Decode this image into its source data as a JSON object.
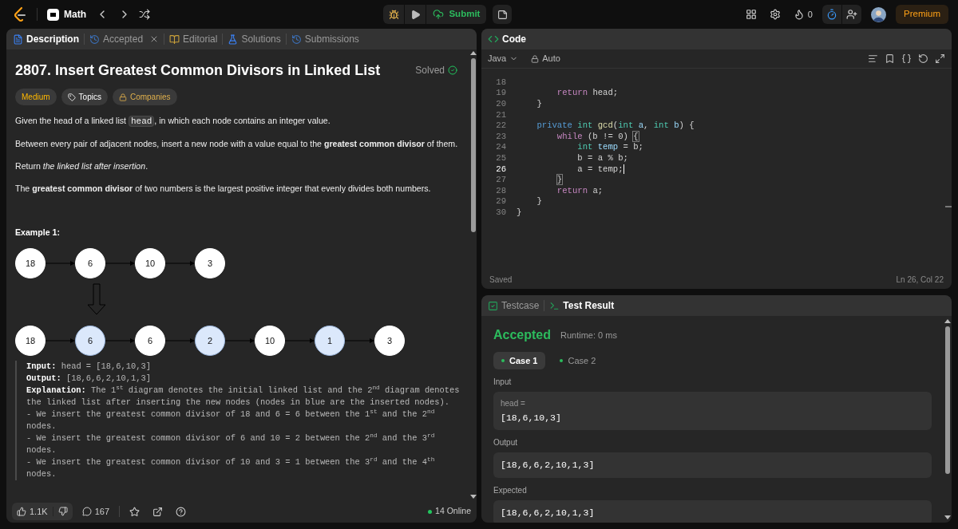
{
  "topbar": {
    "problem_list": "Math",
    "submit": "Submit",
    "streak": "0",
    "timer_active": true,
    "premium": "Premium"
  },
  "description_tabs": [
    {
      "label": "Description",
      "kind": "description",
      "selected": true
    },
    {
      "label": "Accepted",
      "kind": "accepted",
      "selected": false,
      "closable": true
    },
    {
      "label": "Editorial",
      "kind": "editorial",
      "selected": false
    },
    {
      "label": "Solutions",
      "kind": "solutions",
      "selected": false
    },
    {
      "label": "Submissions",
      "kind": "submissions",
      "selected": false
    }
  ],
  "problem": {
    "title": "2807. Insert Greatest Common Divisors in Linked List",
    "status": "Solved",
    "difficulty": "Medium",
    "tags": [
      {
        "label": "Topics",
        "kind": "topics"
      },
      {
        "label": "Companies",
        "kind": "companies"
      }
    ],
    "paragraphs": [
      [
        {
          "kind": "text",
          "text": "Given the head of a linked list "
        },
        {
          "kind": "code",
          "text": "head"
        },
        {
          "kind": "text",
          "text": ", in which each node contains an integer value."
        }
      ],
      [
        {
          "kind": "text",
          "text": "Between every pair of adjacent nodes, insert a new node with a value equal to the **greatest common divisor** of them."
        }
      ],
      [
        {
          "kind": "text",
          "text": "Return *the linked list after insertion*."
        }
      ],
      [
        {
          "kind": "text",
          "text": "The **greatest common divisor** of two numbers is the largest positive integer that evenly divides both numbers."
        }
      ]
    ],
    "example_title": "Example 1:",
    "diagram": {
      "before": [
        {
          "value": "18",
          "inserted": false
        },
        {
          "value": "6",
          "inserted": false
        },
        {
          "value": "10",
          "inserted": false
        },
        {
          "value": "3",
          "inserted": false
        }
      ],
      "after": [
        {
          "value": "18",
          "inserted": false
        },
        {
          "value": "6",
          "inserted": true
        },
        {
          "value": "6",
          "inserted": false
        },
        {
          "value": "2",
          "inserted": true
        },
        {
          "value": "10",
          "inserted": false
        },
        {
          "value": "1",
          "inserted": true
        },
        {
          "value": "3",
          "inserted": false
        }
      ]
    },
    "example": {
      "input_label": "Input:",
      "input": "head = [18,6,10,3]",
      "output_label": "Output:",
      "output": "[18,6,6,2,10,1,3]",
      "explanation_label": "Explanation:",
      "explanation": "The 1$^{st}$ diagram denotes the initial linked list and the 2$^{nd}$ diagram denotes the linked list after inserting the new nodes (nodes in blue are the inserted nodes).",
      "steps": [
        "- We insert the greatest common divisor of 18 and 6 = 6 between the 1$^{st}$ and the 2$^{nd}$ nodes.",
        "- We insert the greatest common divisor of 6 and 10 = 2 between the 2$^{nd}$ and the 3$^{rd}$ nodes.",
        "- We insert the greatest common divisor of 10 and 3 = 1 between the 3$^{rd}$ and the 4$^{th}$ nodes."
      ]
    }
  },
  "footer": {
    "likes": "1.1K",
    "comments": "167",
    "online": "14 Online"
  },
  "code_panel": {
    "title": "Code",
    "language": "Java",
    "mode": "Auto",
    "status": "Saved",
    "cursor": "Ln 26, Col 22",
    "lines": [
      {
        "number": "18",
        "current": false
      },
      {
        "number": "19",
        "current": false,
        "tokens": [
          {
            "text": "        return",
            "kind": "keyword"
          },
          {
            "text": " head;",
            "kind": "plain"
          }
        ]
      },
      {
        "number": "20",
        "current": false,
        "tokens": [
          {
            "text": "    }",
            "kind": "plain"
          }
        ]
      },
      {
        "number": "21",
        "current": false
      },
      {
        "number": "22",
        "current": false,
        "tokens": [
          {
            "text": "    private",
            "kind": "modifier"
          },
          {
            "text": " int",
            "kind": "type"
          },
          {
            "text": " gcd",
            "kind": "function"
          },
          {
            "text": "(",
            "kind": "plain"
          },
          {
            "text": "int",
            "kind": "type"
          },
          {
            "text": " a",
            "kind": "variable"
          },
          {
            "text": ", ",
            "kind": "plain"
          },
          {
            "text": "int",
            "kind": "type"
          },
          {
            "text": " b",
            "kind": "variable"
          },
          {
            "text": ") {",
            "kind": "plain"
          }
        ]
      },
      {
        "number": "23",
        "current": false,
        "tokens": [
          {
            "text": "        while",
            "kind": "keyword"
          },
          {
            "text": " (b != 0) ",
            "kind": "plain"
          },
          {
            "text": "{",
            "kind": "matched"
          }
        ]
      },
      {
        "number": "24",
        "current": false,
        "tokens": [
          {
            "text": "            int",
            "kind": "type"
          },
          {
            "text": " temp",
            "kind": "variable"
          },
          {
            "text": " = b;",
            "kind": "plain"
          }
        ]
      },
      {
        "number": "25",
        "current": false,
        "tokens": [
          {
            "text": "            b = a % b;",
            "kind": "plain"
          }
        ]
      },
      {
        "number": "26",
        "current": true,
        "tokens": [
          {
            "text": "            a = temp;",
            "kind": "plain"
          }
        ]
      },
      {
        "number": "27",
        "current": false,
        "tokens": [
          {
            "text": "        }",
            "kind": "matched"
          }
        ]
      },
      {
        "number": "28",
        "current": false,
        "tokens": [
          {
            "text": "        return",
            "kind": "keyword"
          },
          {
            "text": " a;",
            "kind": "plain"
          }
        ]
      },
      {
        "number": "29",
        "current": false,
        "tokens": [
          {
            "text": "    }",
            "kind": "plain"
          }
        ]
      },
      {
        "number": "30",
        "current": false,
        "tokens": [
          {
            "text": "}",
            "kind": "plain"
          }
        ]
      }
    ]
  },
  "result_tabs": [
    {
      "label": "Testcase",
      "kind": "testcase",
      "selected": false
    },
    {
      "label": "Test Result",
      "kind": "result",
      "selected": true
    }
  ],
  "result": {
    "verdict": "Accepted",
    "runtime": "Runtime: 0 ms",
    "cases": [
      {
        "label": "Case 1",
        "selected": true,
        "passed": true
      },
      {
        "label": "Case 2",
        "selected": false,
        "passed": true
      }
    ],
    "sections": [
      {
        "label": "Input",
        "name": "head =",
        "value": "[18,6,10,3]"
      },
      {
        "label": "Output",
        "value": "[18,6,6,2,10,1,3]"
      },
      {
        "label": "Expected",
        "value": "[18,6,6,2,10,1,3]"
      }
    ]
  }
}
